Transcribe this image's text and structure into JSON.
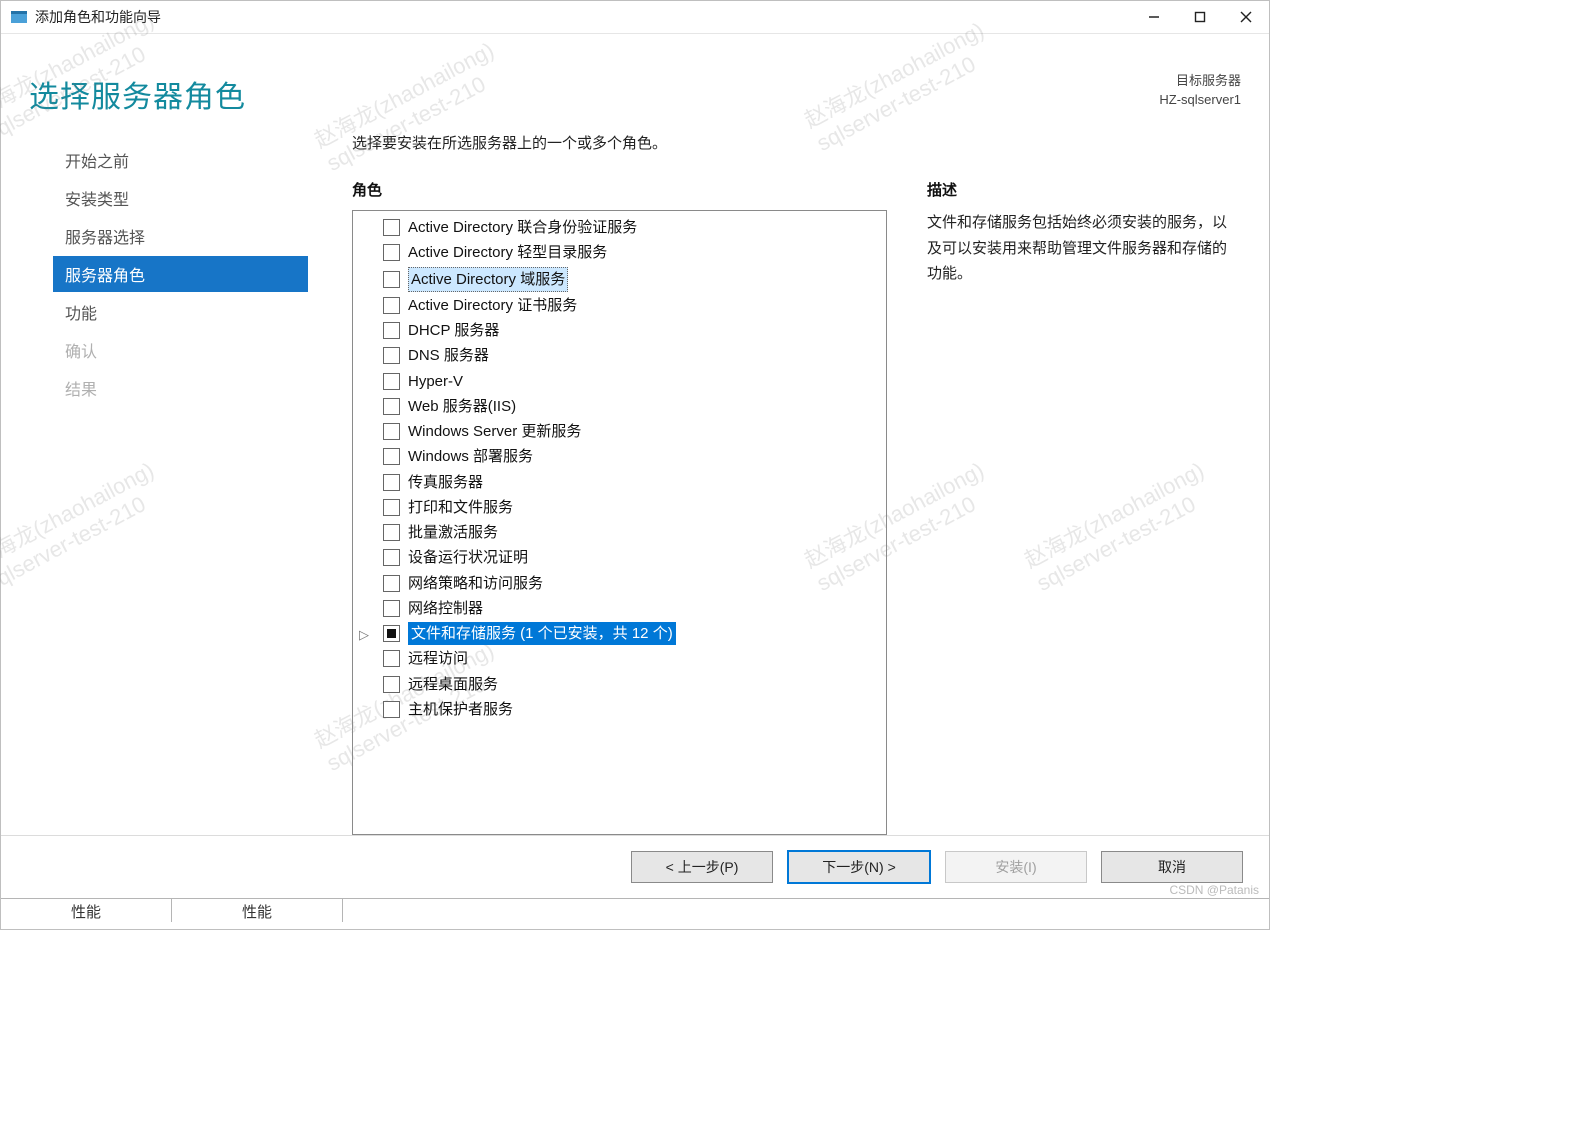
{
  "window": {
    "title": "添加角色和功能向导",
    "page_title": "选择服务器角色",
    "target_label": "目标服务器",
    "target_server": "HZ-sqlserver1",
    "instruction": "选择要安装在所选服务器上的一个或多个角色。"
  },
  "nav": [
    {
      "label": "开始之前",
      "state": "normal"
    },
    {
      "label": "安装类型",
      "state": "normal"
    },
    {
      "label": "服务器选择",
      "state": "normal"
    },
    {
      "label": "服务器角色",
      "state": "selected"
    },
    {
      "label": "功能",
      "state": "normal"
    },
    {
      "label": "确认",
      "state": "disabled"
    },
    {
      "label": "结果",
      "state": "disabled"
    }
  ],
  "roles": {
    "heading": "角色",
    "items": [
      {
        "label": "Active Directory 联合身份验证服务",
        "check": "unchecked"
      },
      {
        "label": "Active Directory 轻型目录服务",
        "check": "unchecked"
      },
      {
        "label": "Active Directory 域服务",
        "check": "unchecked",
        "focus": true
      },
      {
        "label": "Active Directory 证书服务",
        "check": "unchecked"
      },
      {
        "label": "DHCP 服务器",
        "check": "unchecked"
      },
      {
        "label": "DNS 服务器",
        "check": "unchecked"
      },
      {
        "label": "Hyper-V",
        "check": "unchecked"
      },
      {
        "label": "Web 服务器(IIS)",
        "check": "unchecked"
      },
      {
        "label": "Windows Server 更新服务",
        "check": "unchecked"
      },
      {
        "label": "Windows 部署服务",
        "check": "unchecked"
      },
      {
        "label": "传真服务器",
        "check": "unchecked"
      },
      {
        "label": "打印和文件服务",
        "check": "unchecked"
      },
      {
        "label": "批量激活服务",
        "check": "unchecked"
      },
      {
        "label": "设备运行状况证明",
        "check": "unchecked"
      },
      {
        "label": "网络策略和访问服务",
        "check": "unchecked"
      },
      {
        "label": "网络控制器",
        "check": "unchecked"
      },
      {
        "label": "文件和存储服务 (1 个已安装，共 12 个)",
        "check": "indeterminate",
        "highlight": true,
        "expandable": true
      },
      {
        "label": "远程访问",
        "check": "unchecked"
      },
      {
        "label": "远程桌面服务",
        "check": "unchecked"
      },
      {
        "label": "主机保护者服务",
        "check": "unchecked"
      }
    ]
  },
  "description": {
    "heading": "描述",
    "text": "文件和存储服务包括始终必须安装的服务，以及可以安装用来帮助管理文件服务器和存储的功能。"
  },
  "buttons": {
    "prev": "< 上一步(P)",
    "next": "下一步(N) >",
    "install": "安装(I)",
    "cancel": "取消"
  },
  "bottom": {
    "cell1": "性能",
    "cell2": "性能"
  },
  "credit": "CSDN @Patanis",
  "watermark": "赵海龙(zhaohailong)\nsqlserver-test-210"
}
